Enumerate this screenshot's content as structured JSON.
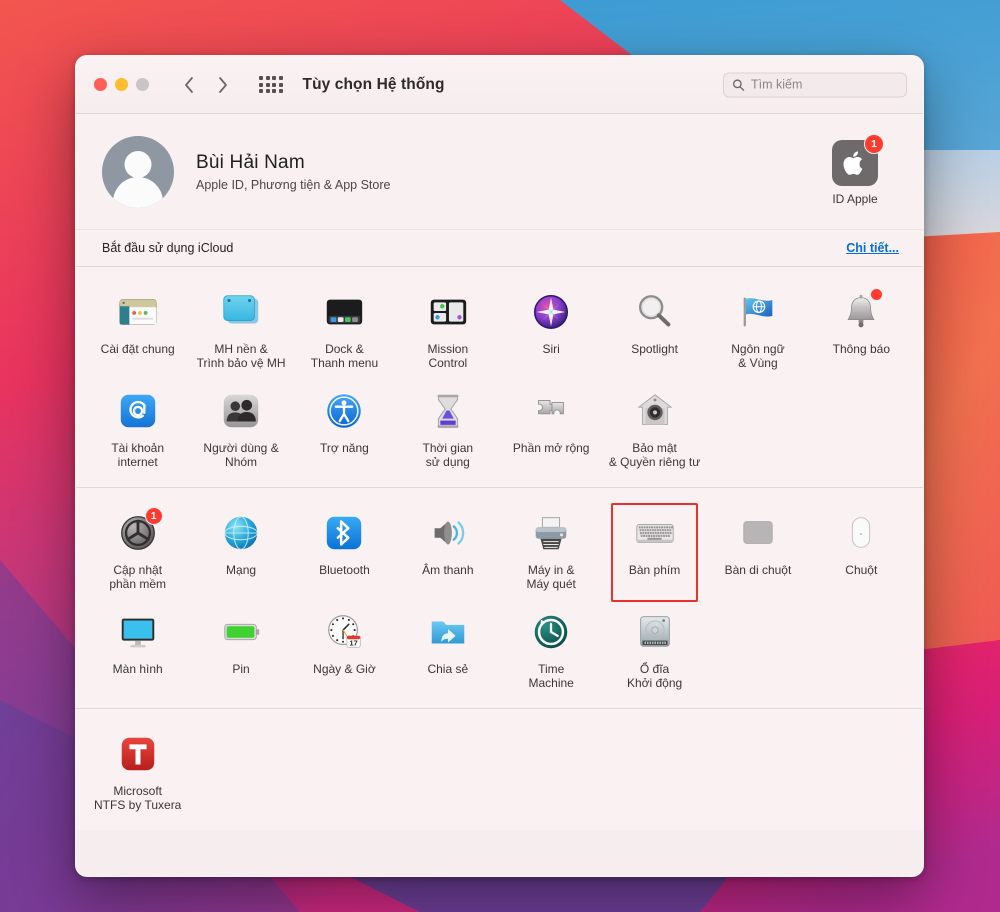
{
  "window": {
    "title": "Tùy chọn Hệ thống",
    "traffic_lights": [
      "close-red",
      "minimize-yellow",
      "zoom-gray"
    ],
    "back_label": "Quay lại",
    "forward_label": "Tiến",
    "grid_label": "Hiện tất cả"
  },
  "search": {
    "placeholder": "Tìm kiếm",
    "value": "",
    "icon": "search-icon"
  },
  "account": {
    "name": "Bùi  Hải Nam",
    "subtitle": "Apple ID, Phương tiện & App Store",
    "avatar_icon": "user-avatar-icon",
    "tile_label": "ID Apple",
    "tile_icon": "apple-logo-icon",
    "tile_badge": "1"
  },
  "icloud": {
    "text": "Bắt đầu sử dụng iCloud",
    "details_link": "Chi tiết...",
    "link_color": "#066fd8"
  },
  "sections": [
    {
      "name": "personal-settings",
      "items": [
        {
          "label": "Cài đặt chung",
          "icon": "general-icon",
          "badge": null
        },
        {
          "label": "MH nền &\nTrình bảo vệ MH",
          "icon": "desktop-screensaver-icon",
          "badge": null
        },
        {
          "label": "Dock &\nThanh menu",
          "icon": "dock-menubar-icon",
          "badge": null
        },
        {
          "label": "Mission\nControl",
          "icon": "mission-control-icon",
          "badge": null
        },
        {
          "label": "Siri",
          "icon": "siri-icon",
          "badge": null
        },
        {
          "label": "Spotlight",
          "icon": "spotlight-icon",
          "badge": null
        },
        {
          "label": "Ngôn ngữ\n& Vùng",
          "icon": "language-region-icon",
          "badge": null
        },
        {
          "label": "Thông báo",
          "icon": "notifications-bell-icon",
          "badge": "dot"
        },
        {
          "label": "Tài khoản\ninternet",
          "icon": "internet-accounts-icon",
          "badge": null
        },
        {
          "label": "Người dùng &\nNhóm",
          "icon": "users-groups-icon",
          "badge": null
        },
        {
          "label": "Trợ năng",
          "icon": "accessibility-icon",
          "badge": null
        },
        {
          "label": "Thời gian\nsử dụng",
          "icon": "screen-time-icon",
          "badge": null
        },
        {
          "label": "Phần mở rộng",
          "icon": "extensions-puzzle-icon",
          "badge": null
        },
        {
          "label": "Bảo mật\n& Quyền riêng tư",
          "icon": "security-privacy-icon",
          "badge": null
        }
      ]
    },
    {
      "name": "hardware-settings",
      "items": [
        {
          "label": "Cập nhật\nphần mềm",
          "icon": "software-update-icon",
          "badge": "1"
        },
        {
          "label": "Mạng",
          "icon": "network-globe-icon",
          "badge": null
        },
        {
          "label": "Bluetooth",
          "icon": "bluetooth-icon",
          "badge": null
        },
        {
          "label": "Âm thanh",
          "icon": "sound-speaker-icon",
          "badge": null
        },
        {
          "label": "Máy in &\nMáy quét",
          "icon": "printers-scanners-icon",
          "badge": null
        },
        {
          "label": "Bàn phím",
          "icon": "keyboard-icon",
          "badge": null,
          "highlighted": true
        },
        {
          "label": "Bàn di chuột",
          "icon": "trackpad-icon",
          "badge": null
        },
        {
          "label": "Chuột",
          "icon": "mouse-icon",
          "badge": null
        },
        {
          "label": "Màn hình",
          "icon": "displays-icon",
          "badge": null
        },
        {
          "label": "Pin",
          "icon": "battery-icon",
          "badge": null
        },
        {
          "label": "Ngày & Giờ",
          "icon": "date-time-clock-icon",
          "badge": null
        },
        {
          "label": "Chia sẻ",
          "icon": "sharing-folder-icon",
          "badge": null
        },
        {
          "label": "Time\nMachine",
          "icon": "time-machine-icon",
          "badge": null
        },
        {
          "label": "Ổ đĩa\nKhởi động",
          "icon": "startup-disk-icon",
          "badge": null
        }
      ]
    },
    {
      "name": "third-party-settings",
      "items": [
        {
          "label": "Microsoft\nNTFS by Tuxera",
          "icon": "tuxera-ntfs-icon",
          "badge": null
        }
      ]
    }
  ],
  "date_icon": {
    "day": "17"
  },
  "colors": {
    "window_background": "#f9f1f2",
    "titlebar": "#f8efef",
    "link_blue": "#066fd8",
    "badge_red": "#ff3b30",
    "highlight_red": "#e8312f",
    "text_primary": "#221f20",
    "text_secondary": "#4b4647"
  }
}
